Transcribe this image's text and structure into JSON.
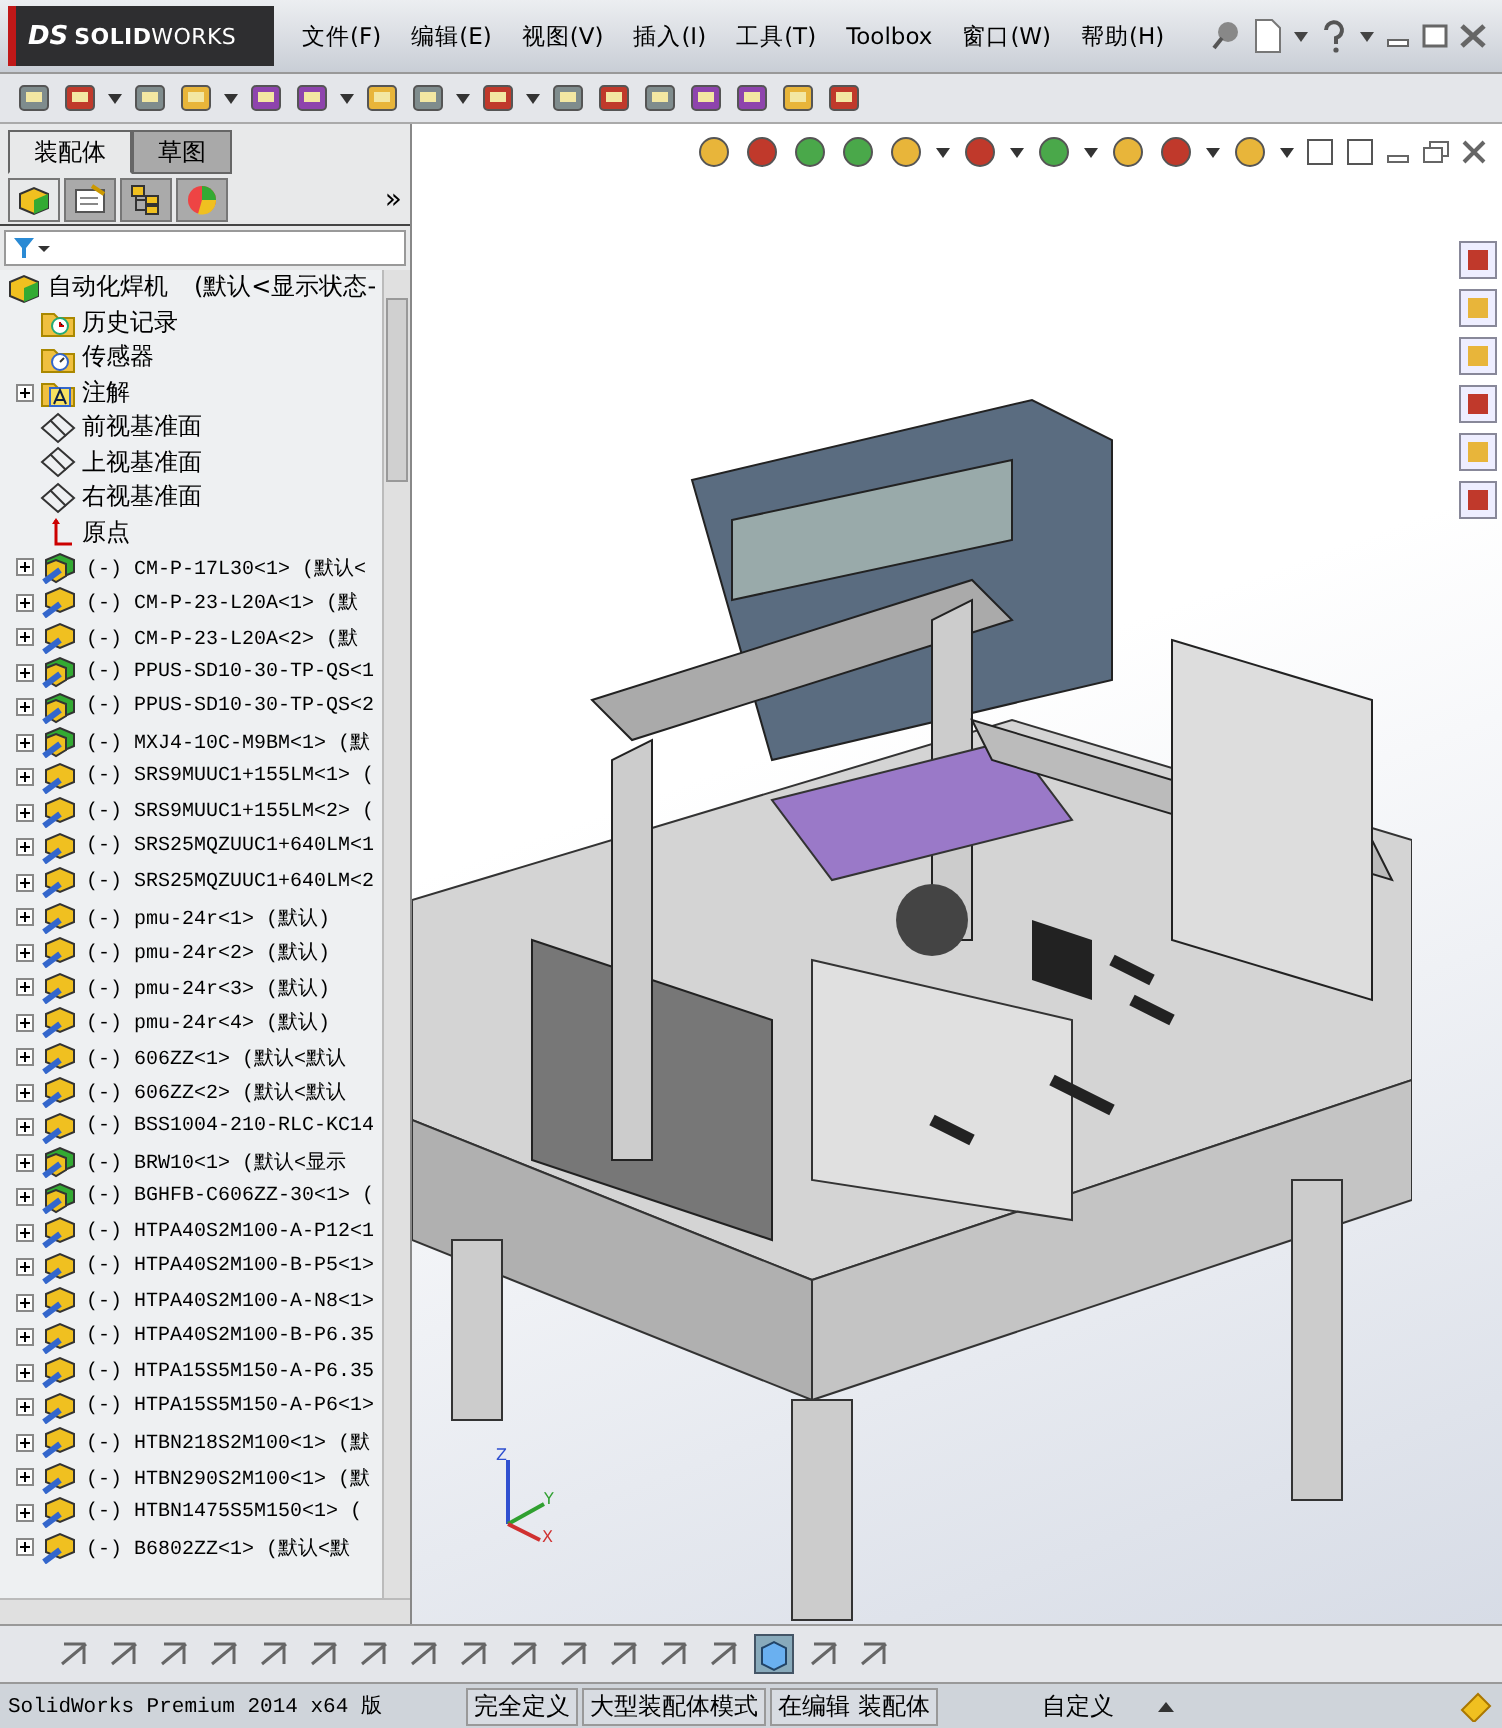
{
  "logo": {
    "mark": "DS",
    "name": "**SOLID**WORKS"
  },
  "menu": [
    "文件(F)",
    "编辑(E)",
    "视图(V)",
    "插入(I)",
    "工具(T)",
    "Toolbox",
    "窗口(W)",
    "帮助(H)"
  ],
  "manager_tabs": [
    {
      "label": "装配体",
      "selected": true
    },
    {
      "label": "草图",
      "selected": false
    }
  ],
  "panel_tabs": [
    {
      "kind": "feature",
      "selected": true
    },
    {
      "kind": "property",
      "selected": false
    },
    {
      "kind": "config",
      "selected": false
    },
    {
      "kind": "display",
      "selected": false
    }
  ],
  "panel_more": "»",
  "tree": {
    "root": {
      "label": "自动化焊机",
      "suffix": "(默认<显示状态-"
    },
    "items": [
      {
        "kind": "history",
        "label": "历史记录",
        "expandable": false
      },
      {
        "kind": "sensors",
        "label": "传感器",
        "expandable": false
      },
      {
        "kind": "annotations",
        "label": "注解",
        "expandable": true
      },
      {
        "kind": "plane",
        "label": "前视基准面",
        "expandable": false
      },
      {
        "kind": "plane",
        "label": "上视基准面",
        "expandable": false
      },
      {
        "kind": "plane",
        "label": "右视基准面",
        "expandable": false
      },
      {
        "kind": "origin",
        "label": "原点",
        "expandable": false
      },
      {
        "kind": "subassembly",
        "label": "(-) CM-P-17L30<1> (默认<",
        "expandable": true
      },
      {
        "kind": "part",
        "label": "(-) CM-P-23-L20A<1> (默",
        "expandable": true
      },
      {
        "kind": "part",
        "label": "(-) CM-P-23-L20A<2> (默",
        "expandable": true
      },
      {
        "kind": "subassembly",
        "label": "(-) PPUS-SD10-30-TP-QS<1",
        "expandable": true
      },
      {
        "kind": "subassembly",
        "label": "(-) PPUS-SD10-30-TP-QS<2",
        "expandable": true
      },
      {
        "kind": "subassembly",
        "label": "(-) MXJ4-10C-M9BM<1> (默",
        "expandable": true
      },
      {
        "kind": "part",
        "label": "(-) SRS9MUUC1+155LM<1> (",
        "expandable": true
      },
      {
        "kind": "part",
        "label": "(-) SRS9MUUC1+155LM<2> (",
        "expandable": true
      },
      {
        "kind": "part",
        "label": "(-) SRS25MQZUUC1+640LM<1",
        "expandable": true
      },
      {
        "kind": "part",
        "label": "(-) SRS25MQZUUC1+640LM<2",
        "expandable": true
      },
      {
        "kind": "part",
        "label": "(-) pmu-24r<1> (默认)",
        "expandable": true
      },
      {
        "kind": "part",
        "label": "(-) pmu-24r<2> (默认)",
        "expandable": true
      },
      {
        "kind": "part",
        "label": "(-) pmu-24r<3> (默认)",
        "expandable": true
      },
      {
        "kind": "part",
        "label": "(-) pmu-24r<4> (默认)",
        "expandable": true
      },
      {
        "kind": "part",
        "label": "(-) 606ZZ<1> (默认<默认",
        "expandable": true
      },
      {
        "kind": "part",
        "label": "(-) 606ZZ<2> (默认<默认",
        "expandable": true
      },
      {
        "kind": "part",
        "label": "(-) BSS1004-210-RLC-KC14",
        "expandable": true
      },
      {
        "kind": "subassembly",
        "label": "(-) BRW10<1> (默认<显示",
        "expandable": true
      },
      {
        "kind": "subassembly",
        "label": "(-) BGHFB-C606ZZ-30<1> (",
        "expandable": true
      },
      {
        "kind": "part",
        "label": "(-) HTPA40S2M100-A-P12<1",
        "expandable": true
      },
      {
        "kind": "part",
        "label": "(-) HTPA40S2M100-B-P5<1>",
        "expandable": true
      },
      {
        "kind": "part",
        "label": "(-) HTPA40S2M100-A-N8<1>",
        "expandable": true
      },
      {
        "kind": "part",
        "label": "(-) HTPA40S2M100-B-P6.35",
        "expandable": true
      },
      {
        "kind": "part",
        "label": "(-) HTPA15S5M150-A-P6.35",
        "expandable": true
      },
      {
        "kind": "part",
        "label": "(-) HTPA15S5M150-A-P6<1>",
        "expandable": true
      },
      {
        "kind": "part",
        "label": "(-) HTBN218S2M100<1> (默",
        "expandable": true
      },
      {
        "kind": "part",
        "label": "(-) HTBN290S2M100<1> (默",
        "expandable": true
      },
      {
        "kind": "part",
        "label": "(-) HTBN1475S5M150<1> (",
        "expandable": true
      },
      {
        "kind": "part",
        "label": "(-) B6802ZZ<1> (默认<默",
        "expandable": true
      }
    ]
  },
  "triad": [
    "Z",
    "Y",
    "X"
  ],
  "status_bar": {
    "product": "SolidWorks Premium 2014 x64 版",
    "cells": [
      "完全定义",
      "大型装配体模式",
      "在编辑 装配体"
    ],
    "units": "自定义"
  }
}
